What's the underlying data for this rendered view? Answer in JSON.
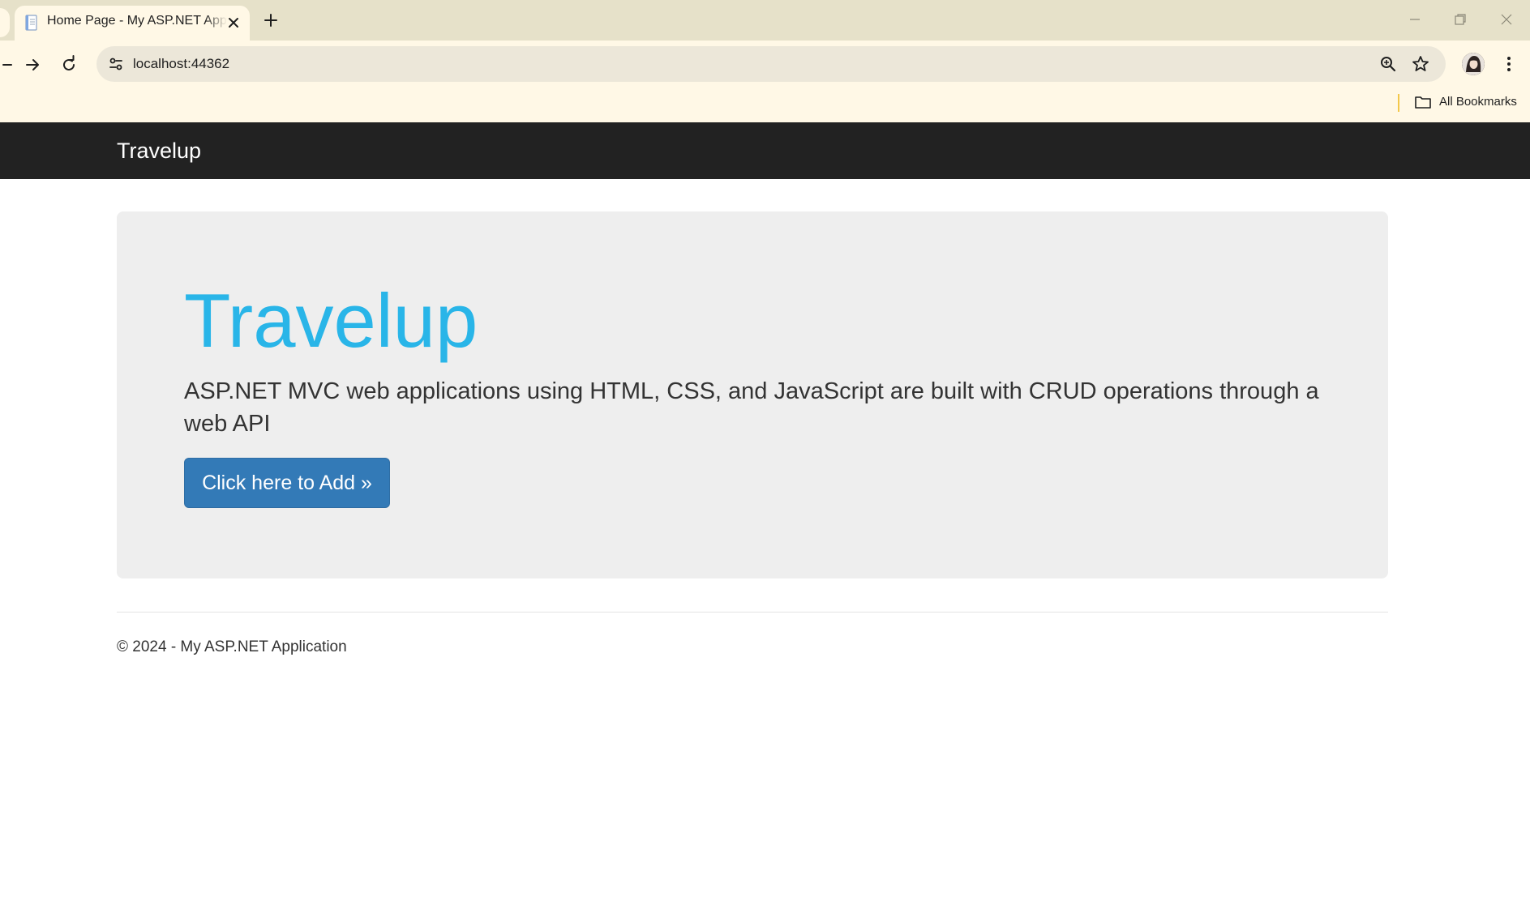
{
  "browser": {
    "tab_title": "Home Page - My ASP.NET Application",
    "url": "localhost:44362",
    "bookmarks_label": "All Bookmarks"
  },
  "page": {
    "brand": "Travelup",
    "jumbotron": {
      "title": "Travelup",
      "lead": "ASP.NET MVC web applications using HTML, CSS, and JavaScript are built with CRUD operations through a web API",
      "button_label": "Click here to Add »"
    },
    "footer": "© 2024 - My ASP.NET Application"
  },
  "colors": {
    "navbar": "#222222",
    "jumbotron_bg": "#eeeeee",
    "title_accent": "#29b5e8",
    "button_primary": "#337ab7",
    "chrome_bg": "#fff8e6",
    "tabstrip_bg": "#e6e1c9"
  },
  "icons": [
    "document-icon",
    "close-icon",
    "plus-icon",
    "minimize-icon",
    "restore-icon",
    "window-close-icon",
    "back-icon",
    "forward-icon",
    "reload-icon",
    "site-settings-icon",
    "zoom-icon",
    "star-icon",
    "profile-avatar",
    "more-vert-icon",
    "folder-icon"
  ]
}
